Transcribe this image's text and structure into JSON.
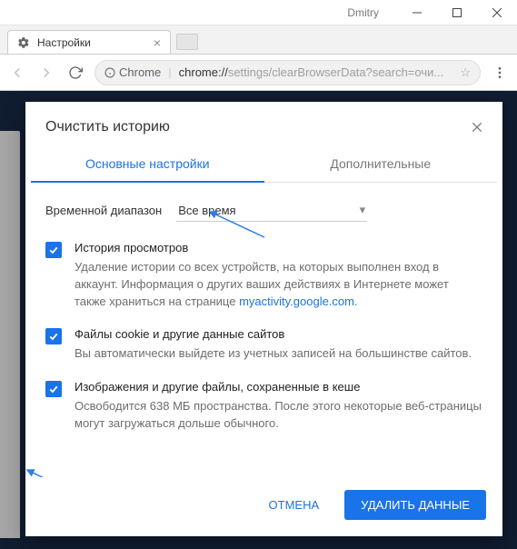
{
  "window": {
    "username": "Dmitry"
  },
  "browser": {
    "tab_title": "Настройки",
    "secure_label": "Chrome",
    "url_host": "chrome://",
    "url_path": "settings/clearBrowserData?search=очи..."
  },
  "dialog": {
    "title": "Очистить историю",
    "tabs": {
      "basic": "Основные настройки",
      "advanced": "Дополнительные"
    },
    "range_label": "Временной диапазон",
    "range_value": "Все время",
    "opts": [
      {
        "title": "История просмотров",
        "desc_part1": "Удаление истории со всех устройств, на которых выполнен вход в аккаунт. Информация о других ваших действиях в Интернете может также храниться на странице ",
        "link": "myactivity.google.com",
        "desc_part2": "."
      },
      {
        "title": "Файлы cookie и другие данные сайтов",
        "desc": "Вы автоматически выйдете из учетных записей на большинстве сайтов."
      },
      {
        "title": "Изображения и другие файлы, сохраненные в кеше",
        "desc": "Освободится 638 МБ пространства. После этого некоторые веб-страницы могут загружаться дольше обычного."
      }
    ],
    "buttons": {
      "cancel": "ОТМЕНА",
      "confirm": "УДАЛИТЬ ДАННЫЕ"
    }
  },
  "colors": {
    "accent": "#1a73e8"
  }
}
